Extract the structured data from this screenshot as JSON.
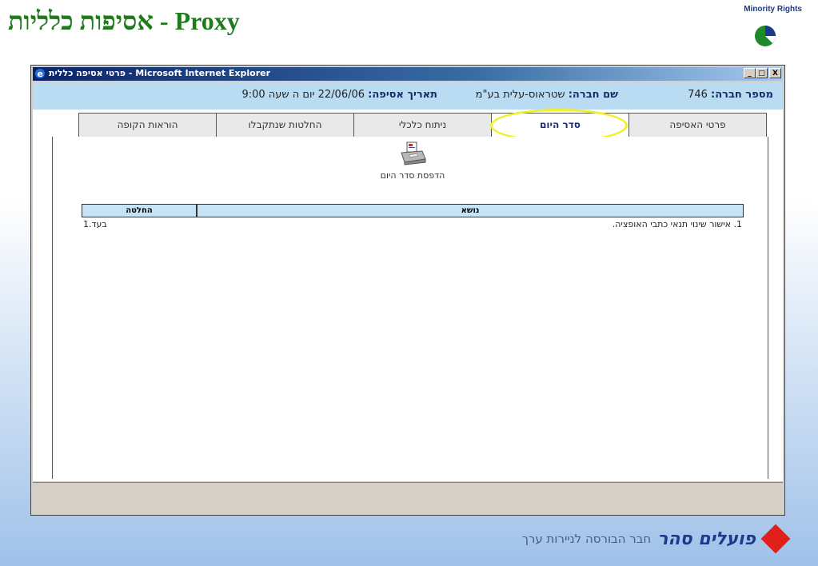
{
  "slide": {
    "title": "אסיפות כלליות - Proxy",
    "brand_label": "Minority Rights"
  },
  "window": {
    "title": "פרטי אסיפה כללית - Microsoft Internet Explorer",
    "buttons": [
      "_",
      "□",
      "X"
    ]
  },
  "info": {
    "company_number_label": "מספר חברה:",
    "company_number": "746",
    "company_name_label": "שם חברה:",
    "company_name": "שטראוס-עלית בע\"מ",
    "meeting_date_label": "תאריך אסיפה:",
    "meeting_date": "22/06/06 יום ה שעה 9:00"
  },
  "tabs": [
    {
      "label": "פרטי האסיפה",
      "active": false
    },
    {
      "label": "סדר היום",
      "active": true
    },
    {
      "label": "ניתוח כלכלי",
      "active": false
    },
    {
      "label": "החלטות שנתקבלו",
      "active": false
    },
    {
      "label": "הוראות הקופה",
      "active": false
    }
  ],
  "print": {
    "label": "הדפסת סדר היום"
  },
  "agenda": {
    "headers": {
      "subject": "נושא",
      "decision": "החלטה"
    },
    "rows": [
      {
        "subject": "1. אישור שינוי תנאי כתבי האופציה.",
        "decision": "1.בעד"
      }
    ]
  },
  "footer": {
    "brand": "פועלים סהר",
    "subtitle": "חבר הבורסה לניירות ערך"
  },
  "colors": {
    "title_green": "#1f7a1a",
    "info_bar": "#b9dcf3",
    "highlight": "#f2ef2b",
    "brand_red": "#e0201a",
    "brand_blue": "#1b3a8c"
  }
}
